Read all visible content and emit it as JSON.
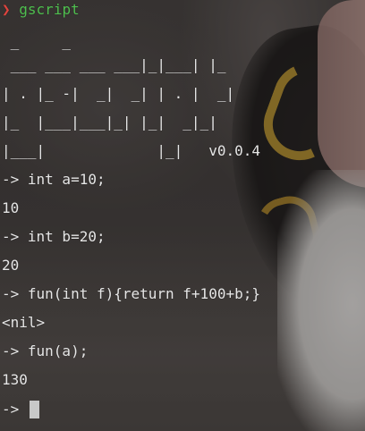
{
  "prompt": {
    "symbol": "❯",
    "command": "gscript"
  },
  "banner": [
    " _     _",
    " ___ ___ ___ ___|_|___| |_",
    "| . |_ -|  _|  _| | . |  _|",
    "|_  |___|___|_| |_|  _|_|",
    "|___|             |_|   v0.0.4"
  ],
  "session": [
    "-> int a=10;",
    "10",
    "-> int b=20;",
    "20",
    "-> fun(int f){return f+100+b;}",
    "<nil>",
    "-> fun(a);",
    "130",
    "-> "
  ],
  "colors": {
    "prompt_chevron": "#e0443e",
    "command_text": "#4fbf4f",
    "output_text": "#e6e6e6",
    "cursor": "#c8c8c8"
  }
}
